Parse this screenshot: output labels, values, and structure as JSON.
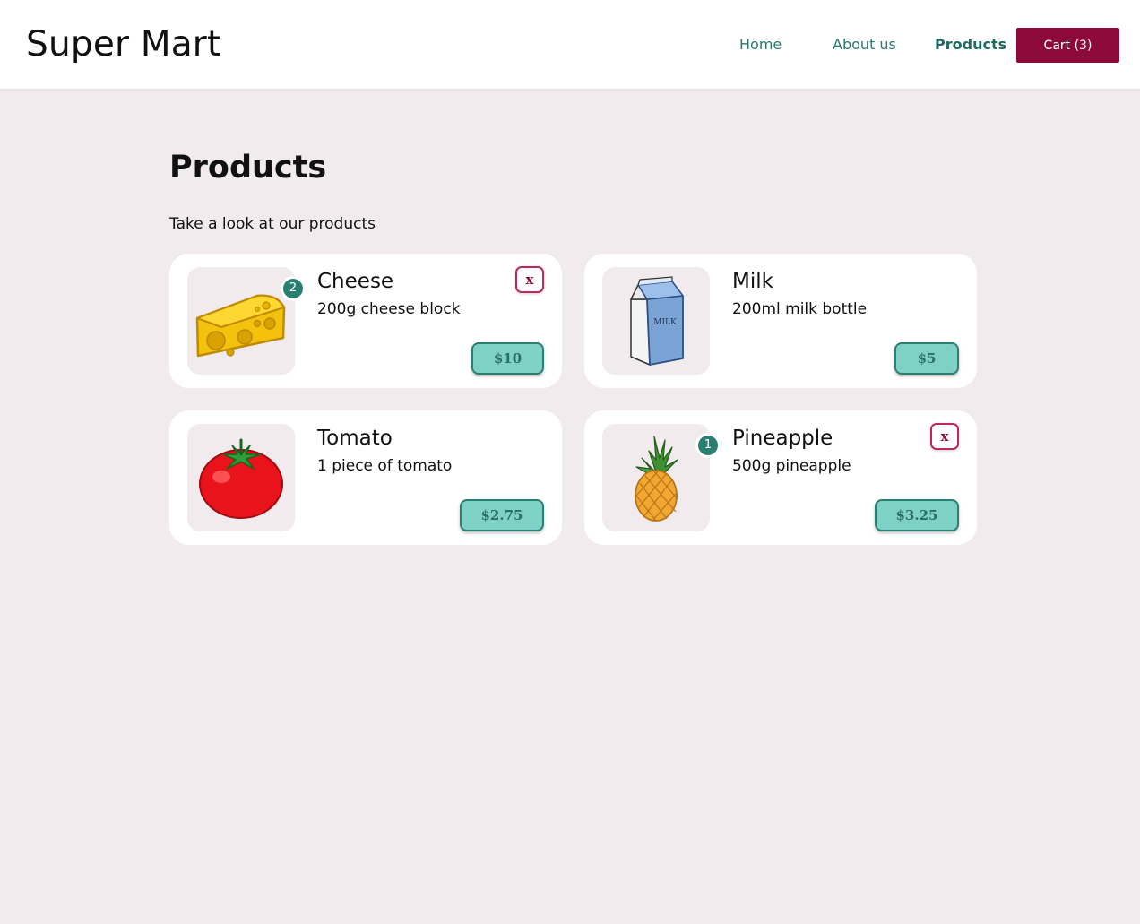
{
  "header": {
    "brand": "Super Mart",
    "nav": {
      "home": "Home",
      "about": "About us",
      "products": "Products"
    },
    "cart_label": "Cart (3)"
  },
  "main": {
    "title": "Products",
    "subtitle": "Take a look at our products"
  },
  "products": [
    {
      "name": "Cheese",
      "description": "200g cheese block",
      "price": "$10",
      "quantity": "2",
      "remove_label": "x",
      "icon": "cheese-icon"
    },
    {
      "name": "Milk",
      "description": "200ml milk bottle",
      "price": "$5",
      "icon": "milk-carton-icon",
      "carton_label": "MILK"
    },
    {
      "name": "Tomato",
      "description": "1 piece of tomato",
      "price": "$2.75",
      "icon": "tomato-icon"
    },
    {
      "name": "Pineapple",
      "description": "500g pineapple",
      "price": "$3.25",
      "quantity": "1",
      "remove_label": "x",
      "icon": "pineapple-icon"
    }
  ],
  "colors": {
    "background": "#f1ebed",
    "accent_teal": "#2a7f73",
    "price_fill": "#7fd1c6",
    "cart_button": "#8b0a3a",
    "remove_border": "#c0265b"
  }
}
